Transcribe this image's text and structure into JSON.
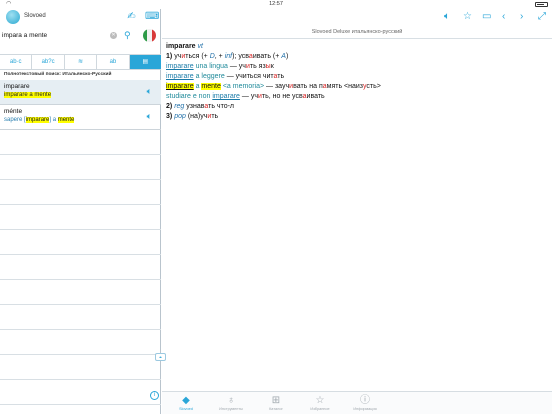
{
  "status": {
    "time": "12:57"
  },
  "app": {
    "name": "Slovoed"
  },
  "search": {
    "value": "impara a mente"
  },
  "modes": [
    {
      "label": "ab·c",
      "icon": "pattern-search-icon"
    },
    {
      "label": "ab?c",
      "icon": "wildcard-search-icon"
    },
    {
      "label": "≋",
      "icon": "fuzzy-search-icon"
    },
    {
      "label": "ab",
      "icon": "anagram-search-icon"
    },
    {
      "label": "▤",
      "icon": "fulltext-search-icon"
    }
  ],
  "section_title": "Полнотекстовый поиск: Итальянско-Русский",
  "results": [
    {
      "word": "imparare",
      "sub_plain": "",
      "sub_parts": [
        "imparare",
        " a ",
        "mente"
      ]
    },
    {
      "word": "ménte",
      "sub_plain": "sapere [",
      "sub_parts": [
        "imparare",
        "] a ",
        "mente"
      ]
    }
  ],
  "right": {
    "title": "Slovoed Deluxe итальянско-русский"
  },
  "article": {
    "headword": "imparare",
    "pos": "vt",
    "sense1_num": "1)",
    "sense1_pre": "уч",
    "sense1_acc1": "и",
    "sense1_mid": "ться (+ ",
    "sense1_arg1": "D",
    "sense1_mid2": ", + ",
    "sense1_arg2": "inf",
    "sense1_mid3": "); усв",
    "sense1_acc2": "а",
    "sense1_post": "ивать (+ ",
    "sense1_arg3": "A",
    "sense1_end": ")",
    "ex1_link": "imparare",
    "ex1_rest": " una lingua",
    "ex1_dash": " — уч",
    "ex1_acc": "и",
    "ex1_tr": "ть яз",
    "ex1_acc2": "ы",
    "ex1_tr2": "к",
    "ex2_link": "imparare",
    "ex2_rest": " a leggere",
    "ex2_dash": " — учи",
    "ex2_tr": "ться чит",
    "ex2_acc": "а",
    "ex2_tr2": "ть",
    "ex3_hl1": "imparare",
    "ex3_a": " a ",
    "ex3_hl2": "mente",
    "ex3_rest": " <a memoria>",
    "ex3_dash": " — зауч",
    "ex3_acc": "и",
    "ex3_tr": "вать на п",
    "ex3_acc2": "а",
    "ex3_tr2": "мять <наиз",
    "ex3_acc3": "у",
    "ex3_tr3": "сть>",
    "ex4_pre": "studiare e non ",
    "ex4_link": "imparare",
    "ex4_dash": " — уч",
    "ex4_acc": "и",
    "ex4_tr": "ть, но не усв",
    "ex4_acc2": "а",
    "ex4_tr2": "ивать",
    "sense2_num": "2)",
    "sense2_lbl": "reg",
    "sense2_pre": " узнав",
    "sense2_acc": "а",
    "sense2_tr": "ть что-л",
    "sense3_num": "3)",
    "sense3_lbl": "pop",
    "sense3_pre": " (на)уч",
    "sense3_acc": "и",
    "sense3_tr": "ть"
  },
  "tabs": [
    {
      "label": "Slovoed",
      "icon": "slovoed-icon"
    },
    {
      "label": "Инструменты",
      "icon": "lightbulb-icon"
    },
    {
      "label": "Каталог",
      "icon": "catalog-icon"
    },
    {
      "label": "Избранное",
      "icon": "star-icon"
    },
    {
      "label": "Информация",
      "icon": "info-icon"
    }
  ],
  "colors": {
    "accent": "#2aa6d8",
    "highlight": "#ffff00",
    "stress": "#d61e1e"
  }
}
